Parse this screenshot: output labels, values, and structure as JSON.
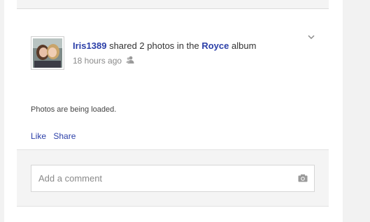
{
  "post": {
    "author": "Iris1389",
    "action_text": "shared 2 photos in the",
    "album": "Royce",
    "album_suffix": "album",
    "time": "18 hours ago",
    "loading_text": "Photos are being loaded.",
    "actions": {
      "like": "Like",
      "share": "Share"
    }
  },
  "comment": {
    "placeholder": "Add a comment"
  },
  "icons": {
    "menu": "chevron-down-icon",
    "privacy": "people-icon",
    "photo": "camera-icon"
  },
  "colors": {
    "link": "#2b3fa8",
    "muted": "#8a8a8a",
    "panel": "#f4f4f4"
  }
}
